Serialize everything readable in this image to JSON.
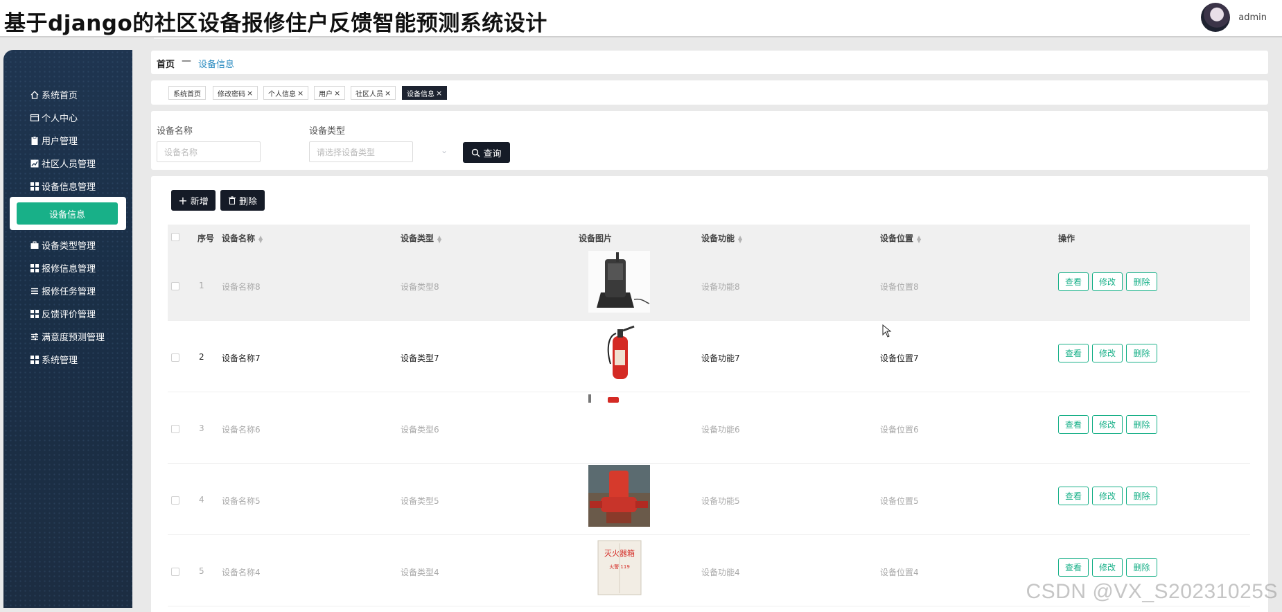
{
  "app": {
    "title": "基于django的社区设备报修住户反馈智能预测系统设计",
    "user": "admin"
  },
  "sidebar": {
    "items": [
      {
        "label": "系统首页",
        "icon": "home-icon"
      },
      {
        "label": "个人中心",
        "icon": "profile-card-icon"
      },
      {
        "label": "用户管理",
        "icon": "clipboard-icon"
      },
      {
        "label": "社区人员管理",
        "icon": "chart-icon"
      },
      {
        "label": "设备信息管理",
        "icon": "grid-icon"
      },
      {
        "label": "设备类型管理",
        "icon": "briefcase-icon"
      },
      {
        "label": "报修信息管理",
        "icon": "grid-icon"
      },
      {
        "label": "报修任务管理",
        "icon": "list-icon"
      },
      {
        "label": "反馈评价管理",
        "icon": "grid-icon"
      },
      {
        "label": "满意度预测管理",
        "icon": "sliders-icon"
      },
      {
        "label": "系统管理",
        "icon": "grid-icon"
      }
    ],
    "active_sub": "设备信息"
  },
  "breadcrumb": {
    "home": "首页",
    "separator": "—",
    "current": "设备信息"
  },
  "tags": [
    {
      "label": "系统首页",
      "closable": false
    },
    {
      "label": "修改密码",
      "closable": true
    },
    {
      "label": "个人信息",
      "closable": true
    },
    {
      "label": "用户",
      "closable": true
    },
    {
      "label": "社区人员",
      "closable": true
    },
    {
      "label": "设备信息",
      "closable": true,
      "active": true
    }
  ],
  "search": {
    "name_label": "设备名称",
    "name_placeholder": "设备名称",
    "type_label": "设备类型",
    "type_placeholder": "请选择设备类型",
    "query_button": "查询"
  },
  "toolbar": {
    "add": "新增",
    "delete": "删除"
  },
  "table": {
    "headers": {
      "index": "序号",
      "name": "设备名称",
      "type": "设备类型",
      "image": "设备图片",
      "function": "设备功能",
      "location": "设备位置",
      "actions": "操作"
    },
    "rows": [
      {
        "index": "1",
        "name": "设备名称8",
        "type": "设备类型8",
        "image": "walkie-talkie",
        "function": "设备功能8",
        "location": "设备位置8"
      },
      {
        "index": "2",
        "name": "设备名称7",
        "type": "设备类型7",
        "image": "fire-extinguisher",
        "function": "设备功能7",
        "location": "设备位置7"
      },
      {
        "index": "3",
        "name": "设备名称6",
        "type": "设备类型6",
        "image": "broken",
        "function": "设备功能6",
        "location": "设备位置6"
      },
      {
        "index": "4",
        "name": "设备名称5",
        "type": "设备类型5",
        "image": "fire-pump",
        "function": "设备功能5",
        "location": "设备位置5"
      },
      {
        "index": "5",
        "name": "设备名称4",
        "type": "设备类型4",
        "image": "fire-box",
        "function": "设备功能4",
        "location": "设备位置4"
      }
    ],
    "action_labels": {
      "view": "查看",
      "edit": "修改",
      "delete": "删除"
    }
  },
  "fire_box_text": {
    "title": "灭火器箱",
    "sub": "火警 119"
  },
  "watermark": "CSDN @VX_S20231025S",
  "colors": {
    "accent": "#18b088",
    "sidebar_bg": "#1f3550",
    "dark_button": "#151b27",
    "link": "#2a8bc0"
  }
}
